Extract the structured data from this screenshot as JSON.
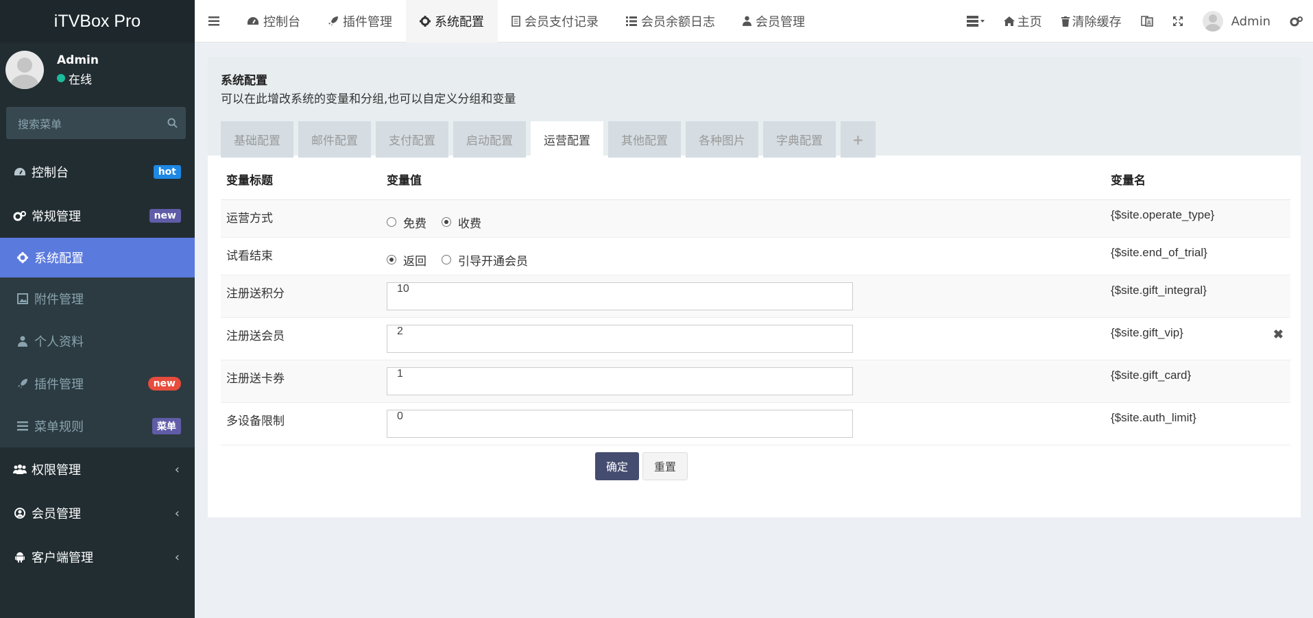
{
  "brand": "iTVBox Pro",
  "user": {
    "name": "Admin",
    "status": "在线"
  },
  "sidebar_search": {
    "placeholder": "搜索菜单"
  },
  "sidebar": {
    "dashboard": {
      "label": "控制台",
      "badge": "hot"
    },
    "general": {
      "label": "常规管理",
      "badge": "new"
    },
    "sys_config": {
      "label": "系统配置"
    },
    "attachments": {
      "label": "附件管理"
    },
    "profile": {
      "label": "个人资料"
    },
    "plugins": {
      "label": "插件管理",
      "badge": "new"
    },
    "menu_rules": {
      "label": "菜单规则",
      "badge": "菜单"
    },
    "auth": {
      "label": "权限管理"
    },
    "members": {
      "label": "会员管理"
    },
    "client": {
      "label": "客户端管理"
    }
  },
  "header": {
    "tabs": [
      "控制台",
      "插件管理",
      "系统配置",
      "会员支付记录",
      "会员余额日志",
      "会员管理"
    ],
    "home": "主页",
    "clear_cache": "清除缓存",
    "admin": "Admin"
  },
  "panel": {
    "title": "系统配置",
    "desc": "可以在此增改系统的变量和分组,也可以自定义分组和变量",
    "tabs": [
      "基础配置",
      "邮件配置",
      "支付配置",
      "启动配置",
      "运营配置",
      "其他配置",
      "各种图片",
      "字典配置"
    ],
    "plus": "+"
  },
  "table": {
    "headers": [
      "变量标题",
      "变量值",
      "变量名"
    ],
    "rows": {
      "operate_type": {
        "title": "运营方式",
        "opt1": "免费",
        "opt2": "收费",
        "var": "{$site.operate_type}"
      },
      "end_of_trial": {
        "title": "试看结束",
        "opt1": "返回",
        "opt2": "引导开通会员",
        "var": "{$site.end_of_trial}"
      },
      "gift_integral": {
        "title": "注册送积分",
        "value": "10",
        "var": "{$site.gift_integral}"
      },
      "gift_vip": {
        "title": "注册送会员",
        "value": "2",
        "var": "{$site.gift_vip}"
      },
      "gift_card": {
        "title": "注册送卡券",
        "value": "1",
        "var": "{$site.gift_card}"
      },
      "auth_limit": {
        "title": "多设备限制",
        "value": "0",
        "var": "{$site.auth_limit}"
      }
    }
  },
  "buttons": {
    "submit": "确定",
    "reset": "重置"
  }
}
